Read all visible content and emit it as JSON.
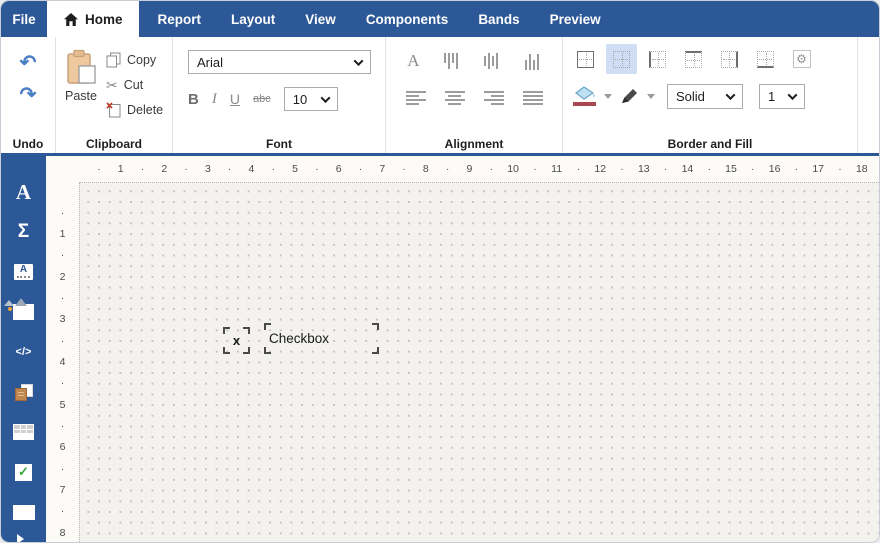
{
  "colors": {
    "menubar_blue": "#2c5898",
    "selected_button_bg": "#cfdef5",
    "fill_swatch_red": "#a84850",
    "undo_arrow_blue": "#4a7ec2",
    "page_background": "#f3f2ee"
  },
  "menubar": {
    "file": "File",
    "home": "Home",
    "tabs": [
      "Report",
      "Layout",
      "View",
      "Components",
      "Bands",
      "Preview"
    ]
  },
  "ribbon": {
    "undo": {
      "label": "Undo",
      "undo_glyph": "↶",
      "redo_glyph": "↷"
    },
    "clipboard": {
      "label": "Clipboard",
      "paste": "Paste",
      "copy": "Copy",
      "cut": "Cut",
      "delete": "Delete",
      "scissors_glyph": "✂"
    },
    "font": {
      "label": "Font",
      "family": "Arial",
      "size": "10",
      "bold": "B",
      "italic": "I",
      "underline": "U",
      "strike": "abc"
    },
    "alignment": {
      "label": "Alignment",
      "font_color_glyph": "A"
    },
    "border": {
      "label": "Border and Fill",
      "line_style": "Solid",
      "line_width": "1",
      "gear_glyph": "⚙"
    }
  },
  "sidebar": {
    "glyphs": {
      "text": "A",
      "formula": "Σ",
      "html": "</>",
      "label_a": "A",
      "check": "✓"
    },
    "tools": [
      "text",
      "formula",
      "label",
      "picture",
      "html",
      "subreport",
      "table",
      "checkbox",
      "barcode",
      "expand"
    ]
  },
  "canvas": {
    "hruler": [
      "·",
      "1",
      "·",
      "2",
      "·",
      "3",
      "·",
      "4",
      "·",
      "5",
      "·",
      "6",
      "·",
      "7",
      "·",
      "8",
      "·",
      "9",
      "·",
      "10",
      "·",
      "11",
      "·",
      "12",
      "·",
      "13",
      "·",
      "14",
      "·",
      "15",
      "·",
      "16",
      "·",
      "17",
      "·",
      "18"
    ],
    "vruler": [
      "·",
      "1",
      "·",
      "2",
      "·",
      "3",
      "·",
      "4",
      "·",
      "5",
      "·",
      "6",
      "·",
      "7",
      "·",
      "8"
    ],
    "checkbox": {
      "mark": "x",
      "label": "Checkbox"
    }
  }
}
